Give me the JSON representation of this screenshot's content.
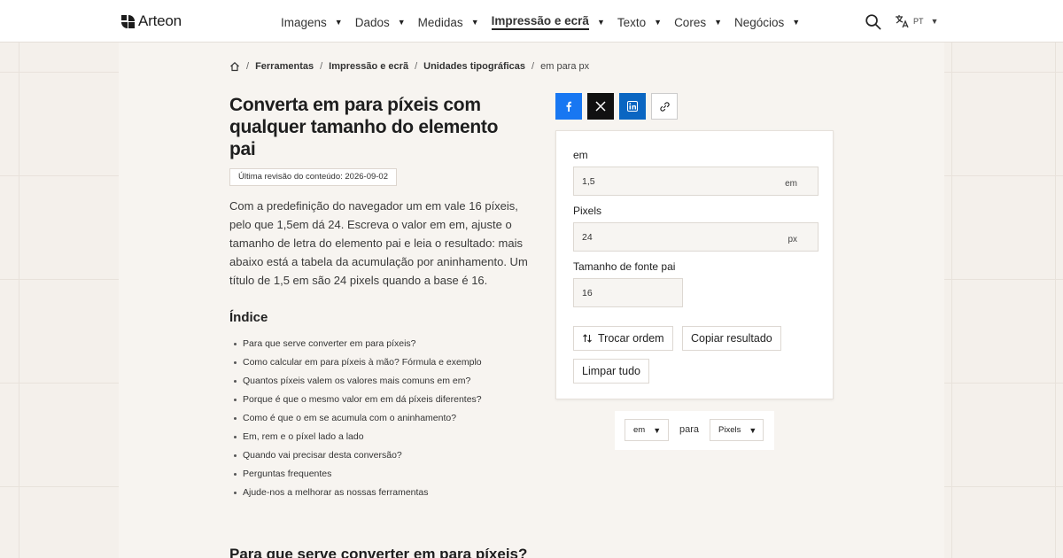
{
  "brand": {
    "name": "Arteon"
  },
  "nav": {
    "items": [
      {
        "label": "Imagens"
      },
      {
        "label": "Dados"
      },
      {
        "label": "Medidas"
      },
      {
        "label": "Impressão e ecrã",
        "active": true
      },
      {
        "label": "Texto"
      },
      {
        "label": "Cores"
      },
      {
        "label": "Negócios"
      }
    ],
    "language": "PT"
  },
  "breadcrumb": {
    "items": [
      "Ferramentas",
      "Impressão e ecrã",
      "Unidades tipográficas"
    ],
    "current": "em para px"
  },
  "page": {
    "title": "Converta em para píxeis com qualquer tamanho do elemento pai",
    "revision": "Última revisão do conteúdo: 2026-09-02",
    "intro": "Com a predefinição do navegador um em vale 16 píxeis, pelo que 1,5em dá 24. Escreva o valor em em, ajuste o tamanho de letra do elemento pai e leia o resultado: mais abaixo está a tabela da acumulação por aninhamento. Um título de 1,5 em são 24 pixels quando a base é 16."
  },
  "toc": {
    "title": "Índice",
    "items": [
      "Para que serve converter em para píxeis?",
      "Como calcular em para píxeis à mão? Fórmula e exemplo",
      "Quantos píxeis valem os valores mais comuns em em?",
      "Porque é que o mesmo valor em em dá píxeis diferentes?",
      "Como é que o em se acumula com o aninhamento?",
      "Em, rem e o píxel lado a lado",
      "Quando vai precisar desta conversão?",
      "Perguntas frequentes",
      "Ajude-nos a melhorar as nossas ferramentas"
    ]
  },
  "section": {
    "heading": "Para que serve converter em para píxeis?"
  },
  "converter": {
    "em": {
      "label": "em",
      "value": "1,5",
      "unit": "em"
    },
    "pixels": {
      "label": "Pixels",
      "value": "24",
      "unit": "px"
    },
    "parent": {
      "label": "Tamanho de fonte pai",
      "value": "16"
    },
    "buttons": {
      "swap": "Trocar ordem",
      "copy": "Copiar resultado",
      "clear": "Limpar tudo"
    }
  },
  "selectors": {
    "from": "em",
    "connector": "para",
    "to": "Pixels"
  },
  "colors": {
    "facebook": "#1877f2",
    "x": "#111111",
    "linkedin": "#0a66c2"
  }
}
